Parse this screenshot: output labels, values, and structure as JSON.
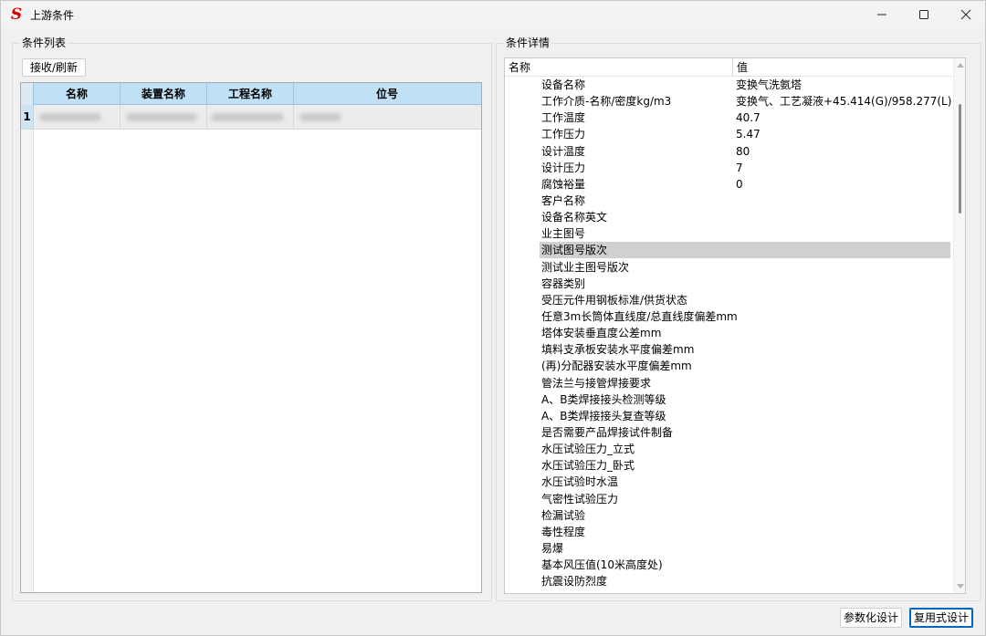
{
  "window": {
    "title": "上游条件",
    "logo_char": "S"
  },
  "list_panel": {
    "title": "条件列表",
    "refresh_button": "接收/刷新",
    "columns": [
      "名称",
      "装置名称",
      "工程名称",
      "位号"
    ],
    "rows": [
      {
        "index": "1"
      }
    ]
  },
  "detail_panel": {
    "title": "条件详情",
    "header": {
      "name": "名称",
      "value": "值"
    },
    "properties": [
      {
        "name": "设备名称",
        "value": "变换气洗氨塔"
      },
      {
        "name": "工作介质-名称/密度kg/m3",
        "value": "变换气、工艺凝液+45.414(G)/958.277(L)"
      },
      {
        "name": "工作温度",
        "value": "40.7"
      },
      {
        "name": "工作压力",
        "value": "5.47"
      },
      {
        "name": "设计温度",
        "value": "80"
      },
      {
        "name": "设计压力",
        "value": "7"
      },
      {
        "name": "腐蚀裕量",
        "value": "0"
      },
      {
        "name": "客户名称",
        "value": ""
      },
      {
        "name": "设备名称英文",
        "value": ""
      },
      {
        "name": "业主图号",
        "value": ""
      },
      {
        "name": "测试图号版次",
        "value": "",
        "selected": true
      },
      {
        "name": "测试业主图号版次",
        "value": ""
      },
      {
        "name": "容器类别",
        "value": ""
      },
      {
        "name": "受压元件用钢板标准/供货状态",
        "value": ""
      },
      {
        "name": "任意3m长筒体直线度/总直线度偏差mm",
        "value": ""
      },
      {
        "name": "塔体安装垂直度公差mm",
        "value": ""
      },
      {
        "name": "填料支承板安装水平度偏差mm",
        "value": ""
      },
      {
        "name": "(再)分配器安装水平度偏差mm",
        "value": ""
      },
      {
        "name": "管法兰与接管焊接要求",
        "value": ""
      },
      {
        "name": "A、B类焊接接头检测等级",
        "value": ""
      },
      {
        "name": "A、B类焊接接头复查等级",
        "value": ""
      },
      {
        "name": "是否需要产品焊接试件制备",
        "value": ""
      },
      {
        "name": "水压试验压力_立式",
        "value": ""
      },
      {
        "name": "水压试验压力_卧式",
        "value": ""
      },
      {
        "name": "水压试验时水温",
        "value": ""
      },
      {
        "name": "气密性试验压力",
        "value": ""
      },
      {
        "name": "检漏试验",
        "value": ""
      },
      {
        "name": "毒性程度",
        "value": ""
      },
      {
        "name": "易爆",
        "value": ""
      },
      {
        "name": "基本风压值(10米高度处)",
        "value": ""
      },
      {
        "name": "抗震设防烈度",
        "value": ""
      }
    ]
  },
  "buttons": {
    "parametric_design": "参数化设计",
    "reuse_design": "复用式设计"
  }
}
